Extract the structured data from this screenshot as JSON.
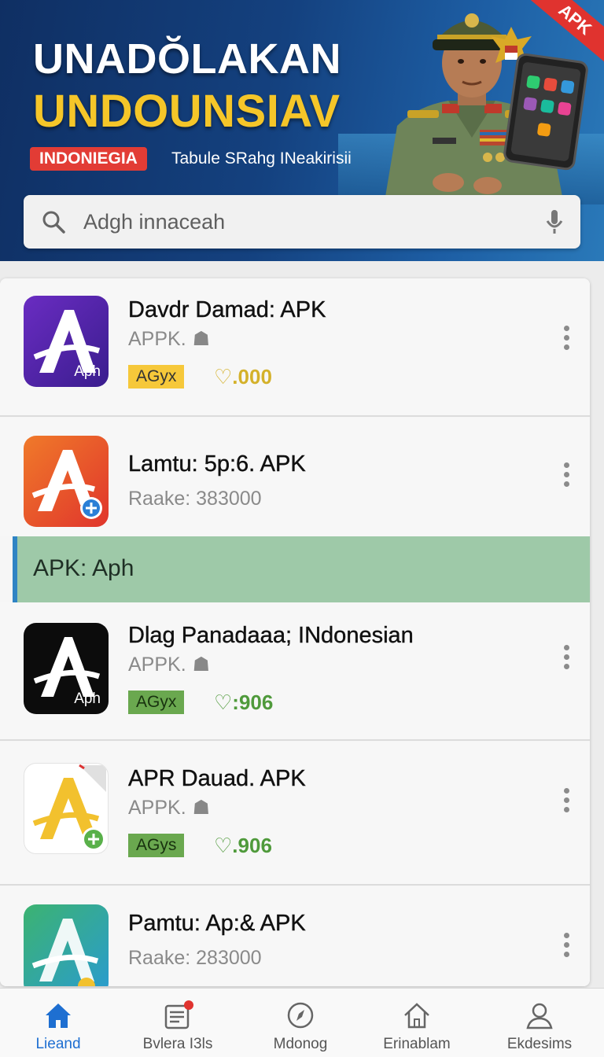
{
  "header": {
    "title_line1": "UNADŎLAKAN",
    "title_line2": "UNDOUNSIAV",
    "badge": "INDONIEGIA",
    "subtitle": "Tabule SRahg INeakirisii",
    "corner_ribbon": "APK"
  },
  "search": {
    "placeholder": "Adgh innaceah",
    "icon": "search-icon",
    "mic_icon": "microphone-icon"
  },
  "section_banner": {
    "label": "APK: Aph"
  },
  "apps": [
    {
      "name": "Davdr Damad: APK",
      "subtitle": "APPK.",
      "tag": "AGyx",
      "rating": "♡.000",
      "icon_label": "Aph"
    },
    {
      "name": "Lamtu: 5p:6. APK",
      "subtitle": "Raake: 383000"
    },
    {
      "name": "Dlag Panadaaa; INdonesian",
      "subtitle": "APPK.",
      "tag": "AGyx",
      "rating": "♡:906",
      "icon_label": "Aph"
    },
    {
      "name": "APR Dauad. APK",
      "subtitle": "APPK.",
      "tag": "AGys",
      "rating": "♡.906"
    },
    {
      "name": "Pamtu: Ap:& APK",
      "subtitle": "Raake: 283000"
    }
  ],
  "bottom_nav": [
    {
      "label": "Lieand",
      "icon": "home-icon",
      "active": true
    },
    {
      "label": "Bvlera I3ls",
      "icon": "news-icon",
      "active": false
    },
    {
      "label": "Mdonog",
      "icon": "compass-icon",
      "active": false
    },
    {
      "label": "Erinablam",
      "icon": "house-outline-icon",
      "active": false
    },
    {
      "label": "Ekdesims",
      "icon": "profile-icon",
      "active": false
    }
  ],
  "colors": {
    "header_bg": "#14417f",
    "title_yellow": "#f5c629",
    "badge_red": "#e23c35",
    "banner_green": "#9ec9a8",
    "accent_blue": "#1e6fd1",
    "tag_yellow": "#f6c83a",
    "tag_green": "#6aa84f"
  }
}
